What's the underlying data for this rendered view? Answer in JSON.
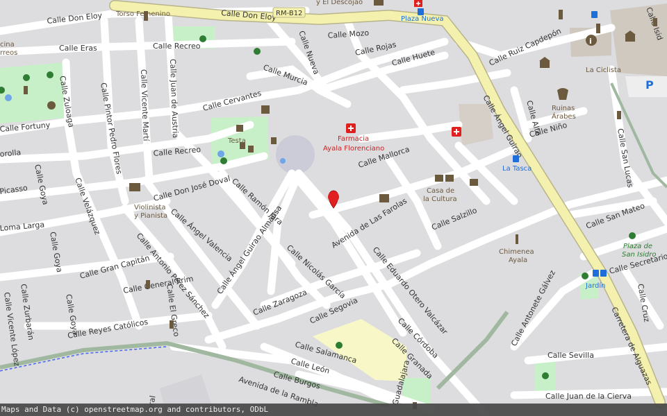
{
  "streets": {
    "don_eloy_top": "Calle Don Eloy",
    "don_eloy_left": "Calle Don Eloy",
    "eras": "Calle Eras",
    "recreo_top": "Calle Recreo",
    "juan_austria": "Calle Juan de Austria",
    "vicente_marti": "Calle Vicente Martí",
    "pintor_pedro_flores": "Calle Pintor Pedro Flores",
    "zuloaga": "Calle Zuloaga",
    "fortuny": "Calle Fortuny",
    "nueva": "Calle Nueva",
    "mozo": "Calle Mozo",
    "rojas": "Calle Rojas",
    "huete": "Calle Huete",
    "murcia": "Calle Murcia",
    "cervantes": "Calle Cervantes",
    "ruiz_capdepon": "Calle Ruiz Capdepón",
    "angel_guirao": "Calle Ángel Guirao",
    "alto": "Calle Alto",
    "nino": "Calle Niño",
    "san_lucas": "Calle San Lucas",
    "mallorca": "Calle Mallorca",
    "recreo": "Calle Recreo",
    "orolla": "orolla",
    "picasso": "Picasso",
    "goya1": "Calle Goya",
    "goya2": "Calle Goya",
    "goya3": "Calle Goya",
    "loma_larga": "Loma Larga",
    "velazquez": "Calle Velázquez",
    "don_jose_doval": "Calle Don José Doval",
    "ramon_jara": "Calle Ramón Jara",
    "angel_valencia": "Calle Ángel Valencia",
    "antonio_perez": "Calle Antonio Pérez Sánchez",
    "angel_guirao_almansa": "Calle Ángel Guirao Almansa",
    "nicolas_garcia": "Calle Nicolás García",
    "av_farolas": "Avenida de Las Farolas",
    "eduardo_otero": "Calle Eduardo Otero Valcázar",
    "salzillo": "Calle Salzillo",
    "san_mateo": "Calle San Mateo",
    "secretario": "Calle Secretario Es",
    "gran_capitan": "Calle Gran Capitán",
    "general_prim": "Calle General Prim",
    "zurbaran": "Calle Zurbarán",
    "vicente_lopez": "Calle Vicente López",
    "el_greco": "Calle El Greco",
    "reyes_catolicos": "Calle Reyes Católicos",
    "zaragoza": "Calle Zaragoza",
    "segovia": "Calle Segovia",
    "cordoba": "Calle Córdoba",
    "granada": "Calle Granada",
    "salamanca": "Calle Salamanca",
    "leon": "Calle León",
    "burgos": "Calle Burgos",
    "av_rambla": "Avenida de la Rambla",
    "guadalajara": "Guadalajara",
    "eral": "eral",
    "antonete": "Calle Antonete Gálvez",
    "sevilla": "Calle Sevilla",
    "juan_cierva": "Calle Juan de la Cierva",
    "carretera": "Carretera de Alguazas",
    "cruz": "Calle Cruz",
    "isid": "Calle Isid"
  },
  "road_refs": {
    "rm_b12": "RM-B12"
  },
  "pois": {
    "torso": "Torso Femenino",
    "descojao": "y El Descojao",
    "plaza_nueva": "Plaza Nueva",
    "farmacia_line1": "Farmacia",
    "farmacia_line2": "Ayala Florenciano",
    "testa": "Testa",
    "casa_cultura_line1": "Casa de",
    "casa_cultura_line2": "la Cultura",
    "la_ciclista": "La Ciclista",
    "ruinas_line1": "Ruinas",
    "ruinas_line2": "Árabes",
    "la_tasca": "La Tasca",
    "chimenea_line1": "Chimenea",
    "chimenea_line2": "Ayala",
    "violinista_line1": "Violinista",
    "violinista_line2": "y Pianista",
    "plaza_san_isidro_line1": "Plaza de",
    "plaza_san_isidro_line2": "San Isidro",
    "jardin": "Jardín",
    "cina": "cina",
    "rreos": "rreos"
  },
  "colors": {
    "background": "#dddcdf",
    "primary_road": "#f4f1ae",
    "park": "#c8f0c8",
    "pedestrian": "#dcdce4",
    "marker": "#e02020"
  },
  "attribution": "Maps and Data (c) openstreetmap.org and contributors, ODbL"
}
